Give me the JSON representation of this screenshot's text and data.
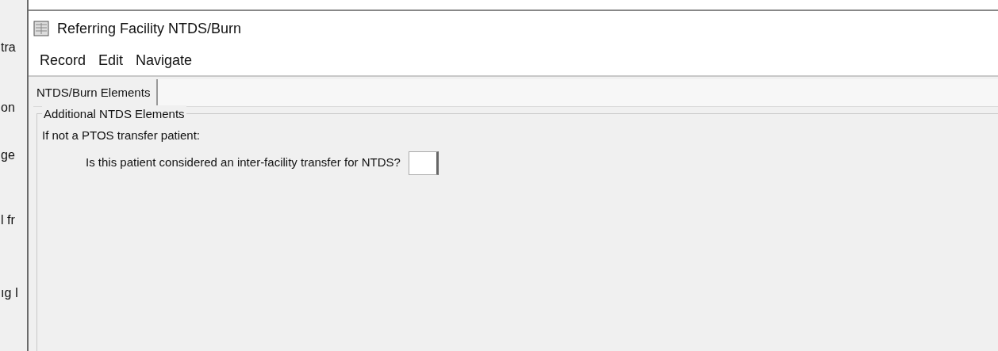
{
  "background_window": {
    "fragments": [
      "tra",
      "on",
      "ge",
      "l fr",
      "ıg I"
    ]
  },
  "window": {
    "title": "Referring Facility NTDS/Burn"
  },
  "menu": [
    "Record",
    "Edit",
    "Navigate"
  ],
  "tabs": [
    {
      "label": "NTDS/Burn Elements",
      "selected": true
    }
  ],
  "group": {
    "title": "Additional NTDS Elements",
    "intro": "If not a PTOS transfer patient:",
    "question": {
      "label": "Is this patient considered an inter-facility transfer for NTDS?"
    }
  }
}
